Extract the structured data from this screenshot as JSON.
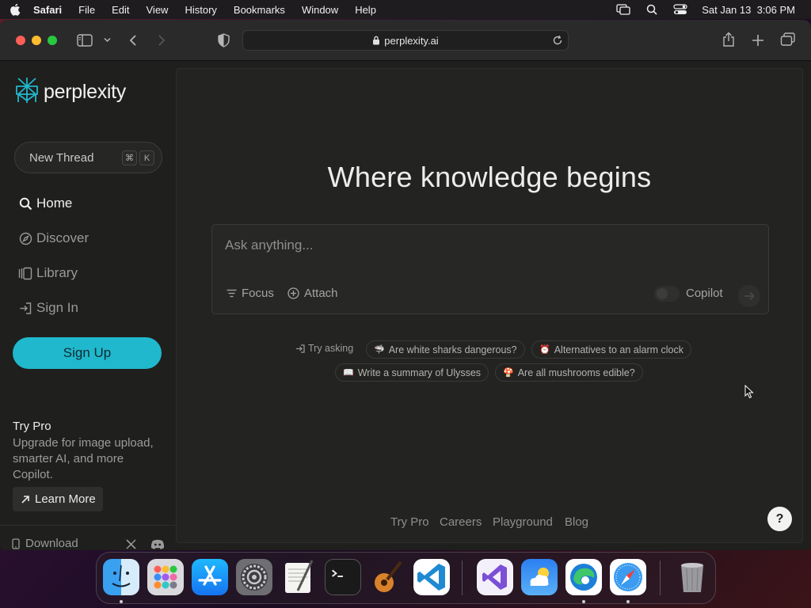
{
  "menubar": {
    "app_name": "Safari",
    "items": [
      "File",
      "Edit",
      "View",
      "History",
      "Bookmarks",
      "Window",
      "Help"
    ],
    "clock": "Sat Jan 13  3:06 PM",
    "status_icons": [
      "screen-mirroring-icon",
      "spotlight-search-icon",
      "control-center-icon"
    ]
  },
  "browser": {
    "url": "perplexity.ai",
    "traffic_lights": [
      "#fe5f57",
      "#febc2e",
      "#28c840"
    ]
  },
  "sidebar": {
    "logo_text": "perplexity",
    "new_thread_label": "New Thread",
    "shortcut_keys": [
      "⌘",
      "K"
    ],
    "nav": [
      {
        "label": "Home",
        "icon": "search-icon",
        "active": true
      },
      {
        "label": "Discover",
        "icon": "compass-icon",
        "active": false
      },
      {
        "label": "Library",
        "icon": "library-icon",
        "active": false
      },
      {
        "label": "Sign In",
        "icon": "sign-in-icon",
        "active": false
      }
    ],
    "signup_label": "Sign Up",
    "try_pro_title": "Try Pro",
    "try_pro_desc": "Upgrade for image upload, smarter AI, and more Copilot.",
    "learn_more_label": "Learn More",
    "download_label": "Download"
  },
  "main": {
    "headline": "Where knowledge begins",
    "ask_placeholder": "Ask anything...",
    "focus_label": "Focus",
    "attach_label": "Attach",
    "copilot_label": "Copilot",
    "try_asking_label": "Try asking",
    "suggestions": [
      {
        "emoji": "🦈",
        "text": "Are white sharks dangerous?"
      },
      {
        "emoji": "⏰",
        "text": "Alternatives to an alarm clock"
      },
      {
        "emoji": "📖",
        "text": "Write a summary of Ulysses"
      },
      {
        "emoji": "🍄",
        "text": "Are all mushrooms edible?"
      }
    ],
    "footer_links": [
      "Try Pro",
      "Careers",
      "Playground",
      "Blog"
    ],
    "help_label": "?"
  },
  "colors": {
    "accent": "#20b8cd",
    "background": "#1f1f1d"
  },
  "dock": {
    "apps": [
      "Finder",
      "Launchpad",
      "App Store",
      "System Settings",
      "TextEdit",
      "Terminal",
      "GarageBand",
      "Visual Studio Code",
      "Visual Studio",
      "Weather",
      "Microsoft Edge",
      "Safari",
      "Trash"
    ]
  }
}
